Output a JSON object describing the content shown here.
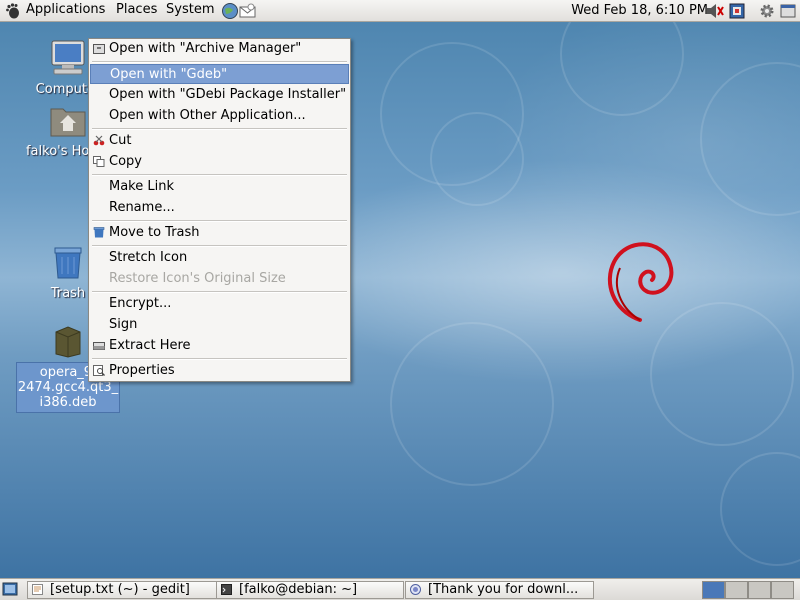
{
  "top_panel": {
    "menus": [
      "Applications",
      "Places",
      "System"
    ],
    "clock": "Wed Feb 18,  6:10 PM"
  },
  "desktop": {
    "icons": [
      {
        "label": "Computer"
      },
      {
        "label": "falko's Home"
      },
      {
        "label": "Trash"
      },
      {
        "label_lines": [
          "opera_9.",
          "2474.gcc4.qt3_",
          "i386.deb"
        ]
      }
    ]
  },
  "context_menu": {
    "items": [
      {
        "text": "Open with \"Archive Manager\""
      },
      {
        "text": "Open with \"Gdeb\"",
        "highlighted": true
      },
      {
        "text": "Open with \"GDebi Package Installer\""
      },
      {
        "text": "Open with Other Application..."
      },
      {
        "text": "Cut"
      },
      {
        "text": "Copy"
      },
      {
        "text": "Make Link"
      },
      {
        "text": "Rename..."
      },
      {
        "text": "Move to Trash"
      },
      {
        "text": "Stretch Icon"
      },
      {
        "text": "Restore Icon's Original Size",
        "disabled": true
      },
      {
        "text": "Encrypt..."
      },
      {
        "text": "Sign"
      },
      {
        "text": "Extract Here"
      },
      {
        "text": "Properties"
      }
    ]
  },
  "taskbar": {
    "tasks": [
      {
        "label": "[setup.txt (~) - gedit]",
        "icon": "text-editor-icon"
      },
      {
        "label": "[falko@debian: ~]",
        "icon": "terminal-icon"
      },
      {
        "label": "[Thank you for downl...",
        "icon": "browser-icon"
      }
    ],
    "workspaces": 4,
    "active_workspace": 1
  },
  "colors": {
    "highlight": "#7d9fd3",
    "desktop_blue": "#4f86b0",
    "debian_red": "#d0111e"
  }
}
